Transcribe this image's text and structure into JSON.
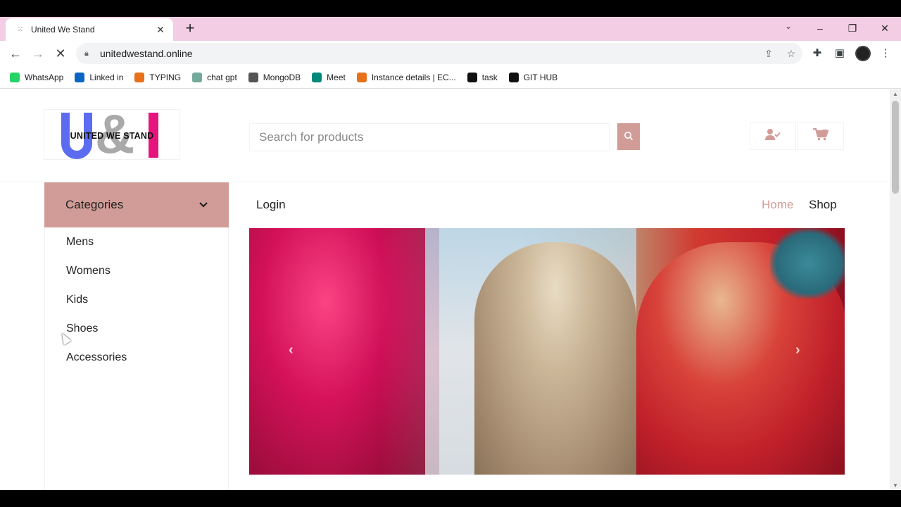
{
  "browser": {
    "tab_title": "United We Stand",
    "tab_close": "✕",
    "new_tab": "+",
    "url": "unitedwestand.online",
    "controls": {
      "minimize": "–",
      "restore": "❐",
      "close": "✕"
    }
  },
  "bookmarks": [
    {
      "label": "WhatsApp",
      "icon": "whatsapp-icon",
      "color": "#25d366"
    },
    {
      "label": "Linked in",
      "icon": "linkedin-icon",
      "color": "#0a66c2"
    },
    {
      "label": "TYPING",
      "icon": "typing-icon",
      "color": "#e8711a"
    },
    {
      "label": "chat gpt",
      "icon": "chatgpt-icon",
      "color": "#74aa9c"
    },
    {
      "label": "MongoDB",
      "icon": "mongodb-icon",
      "color": "#555555"
    },
    {
      "label": "Meet",
      "icon": "meet-icon",
      "color": "#00897b"
    },
    {
      "label": "Instance details | EC...",
      "icon": "aws-icon",
      "color": "#e8711a"
    },
    {
      "label": "task",
      "icon": "github-icon",
      "color": "#111111"
    },
    {
      "label": "GIT HUB",
      "icon": "github-icon",
      "color": "#111111"
    }
  ],
  "site": {
    "logo_text": "UNITED WE STAND",
    "search_placeholder": "Search for products",
    "categories_label": "Categories",
    "categories": [
      "Mens",
      "Womens",
      "Kids",
      "Shoes",
      "Accessories"
    ],
    "nav": {
      "login": "Login",
      "home": "Home",
      "shop": "Shop"
    },
    "accent_color": "#d19c97"
  }
}
